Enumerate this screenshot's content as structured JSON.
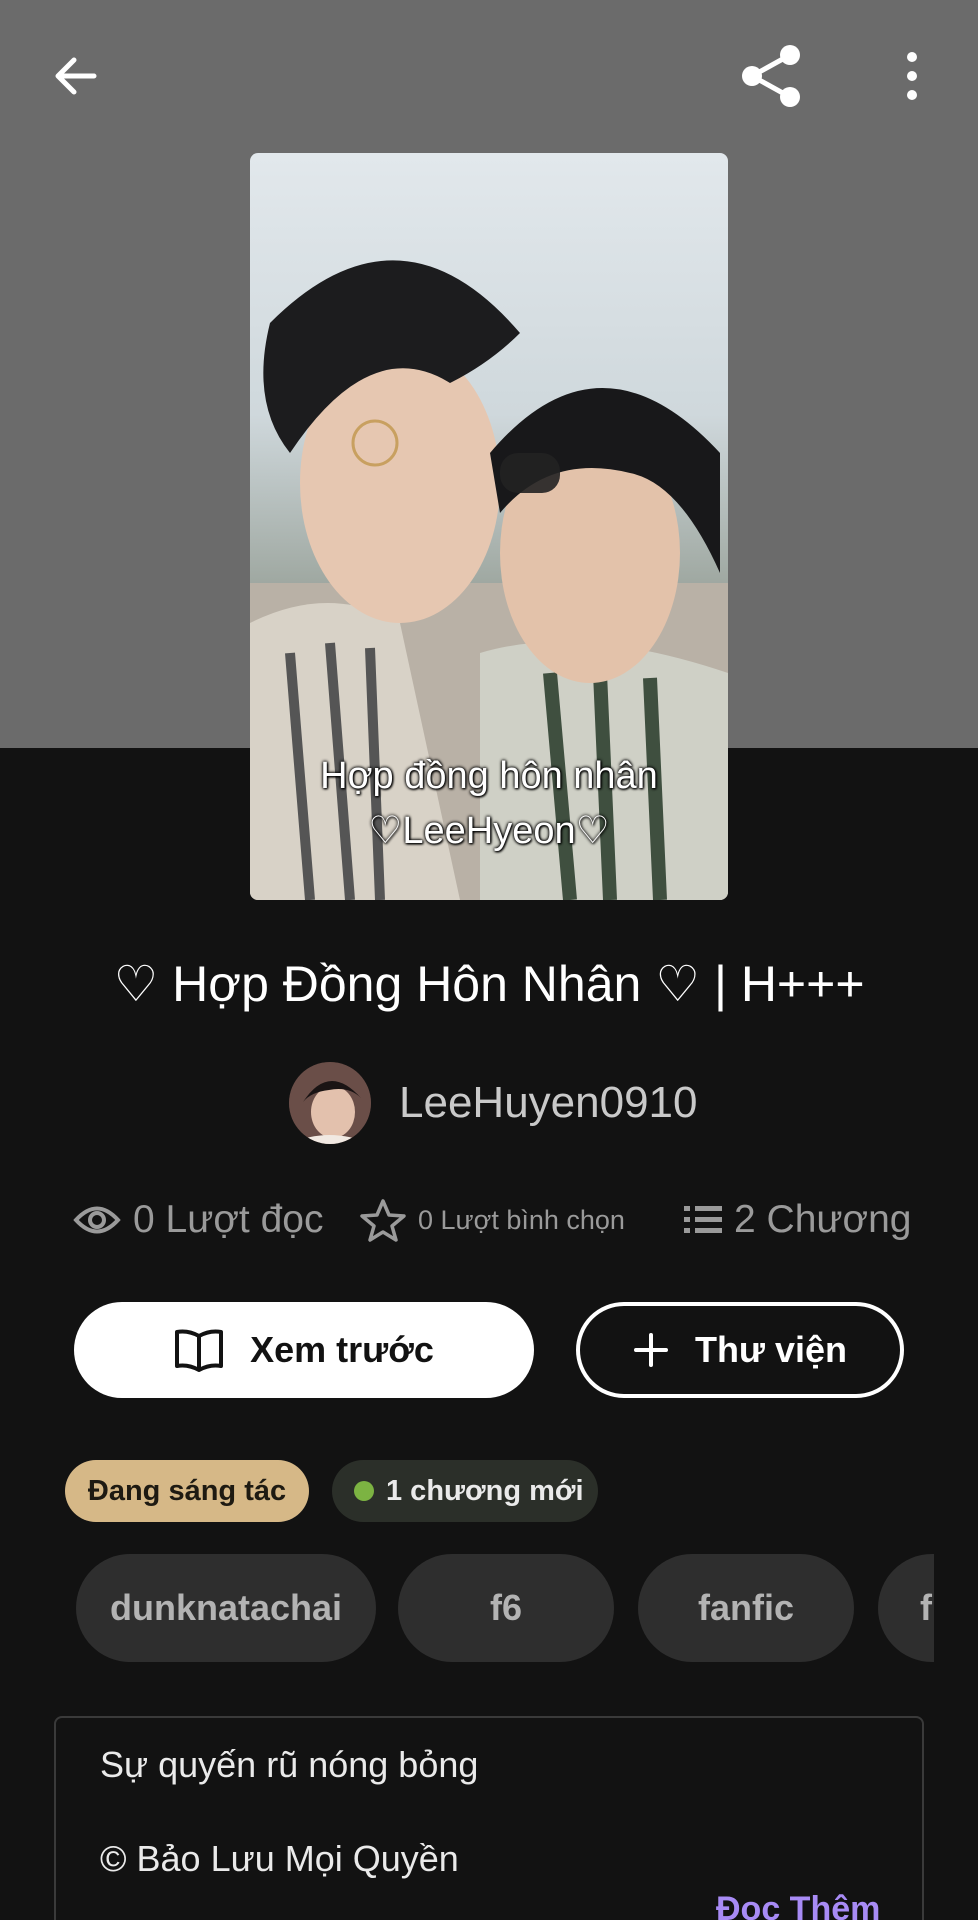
{
  "toolbar": {
    "back_icon": "arrow-left-icon",
    "share_icon": "share-icon",
    "more_icon": "more-vertical-icon"
  },
  "cover": {
    "line1": "Hợp đồng hôn nhân",
    "line2": "♡LeeHyeon♡"
  },
  "story": {
    "title": "♡ Hợp Đồng Hôn Nhân ♡ | H+++",
    "author": "LeeHuyen0910"
  },
  "stats": {
    "reads": "0 Lượt đọc",
    "votes": "0 Lượt bình chọn",
    "chapters": "2 Chương"
  },
  "actions": {
    "preview_label": "Xem trước",
    "library_label": "Thư viện"
  },
  "badges": {
    "status": "Đang sáng tác",
    "new_chapters": "1 chương mới"
  },
  "tags": [
    "dunknatachai",
    "f6",
    "fanfic",
    "f"
  ],
  "description": {
    "line1": "Sự quyến rũ nóng bỏng",
    "line2": "© Bảo Lưu Mọi Quyền",
    "read_more": "Đọc Thêm"
  },
  "colors": {
    "hero_bg": "#6b6b6b",
    "page_bg": "#121212",
    "status_badge": "#d6b887",
    "new_dot": "#7cb342",
    "read_more": "#a88bf5"
  }
}
